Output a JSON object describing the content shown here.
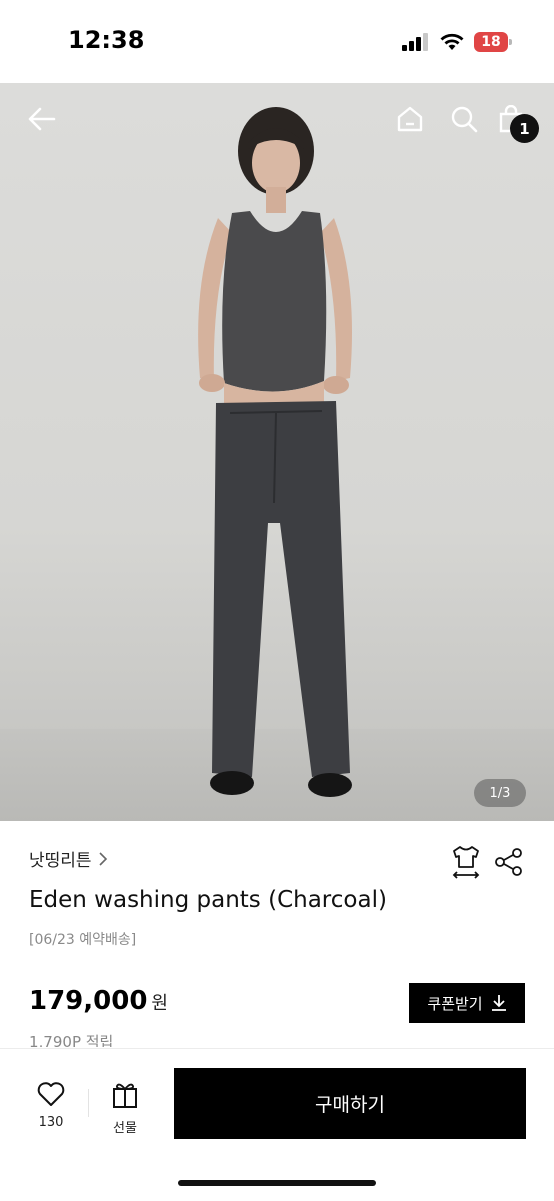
{
  "status_bar": {
    "time": "12:38",
    "battery": "18"
  },
  "hero": {
    "page_indicator": "1/3",
    "cart_count": "1"
  },
  "product": {
    "brand": "낫띵리튼",
    "title": "Eden washing pants (Charcoal)",
    "preorder_note": "[06/23 예약배송]",
    "price": "179,000",
    "currency": "원",
    "coupon_label": "쿠폰받기",
    "points": "1,790P 적립"
  },
  "bottom_bar": {
    "like_count": "130",
    "gift_label": "선물",
    "buy_label": "구매하기"
  },
  "icons": {
    "back": "back-arrow-icon",
    "home": "home-icon",
    "search": "search-icon",
    "cart": "cart-icon",
    "size": "size-guide-icon",
    "share": "share-icon",
    "download": "download-icon",
    "heart": "heart-icon",
    "gift": "gift-icon"
  }
}
